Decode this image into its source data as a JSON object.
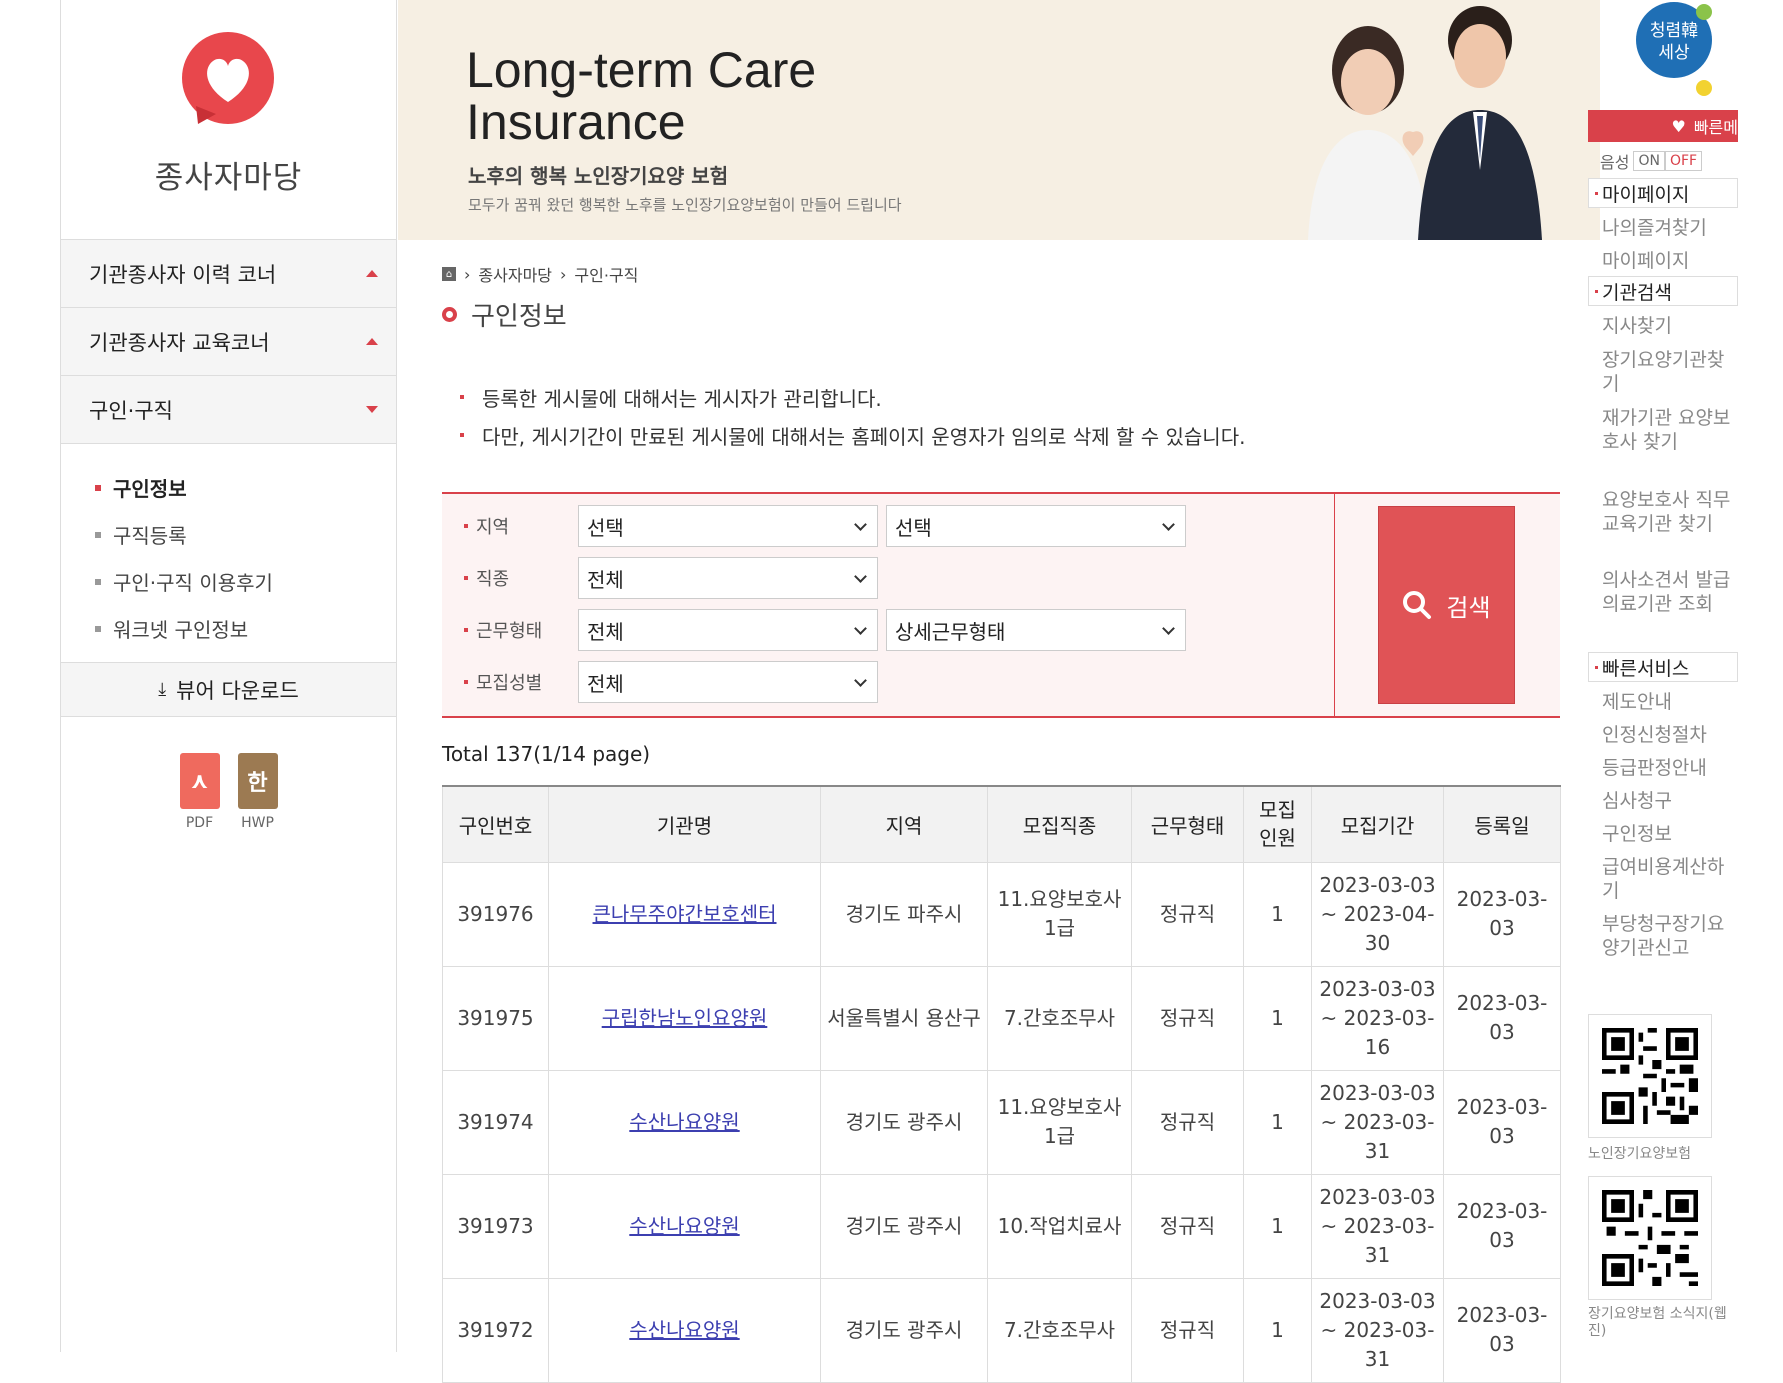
{
  "brand": {
    "name": "종사자마당",
    "logo_icon": "heart-speech-icon"
  },
  "banner": {
    "title_line1": "Long-term Care",
    "title_line2": "Insurance",
    "subtitle": "노후의 행복 노인장기요양 보험",
    "description": "모두가 꿈꿔 왔던 행복한 노후를 노인장기요양보험이 만들어 드립니다"
  },
  "sidebar": {
    "menu": [
      {
        "label": "기관종사자 이력 코너",
        "expanded": false
      },
      {
        "label": "기관종사자 교육코너",
        "expanded": false
      },
      {
        "label": "구인·구직",
        "expanded": true
      }
    ],
    "submenu": [
      {
        "label": "구인정보",
        "active": true
      },
      {
        "label": "구직등록"
      },
      {
        "label": "구인·구직 이용후기"
      },
      {
        "label": "워크넷 구인정보"
      }
    ],
    "viewer_download": "뷰어 다운로드",
    "viewer_pdf": "PDF",
    "viewer_hwp": "HWP",
    "viewer_hwp_glyph": "한"
  },
  "breadcrumb": {
    "home_icon": "home-icon",
    "items": [
      "종사자마당",
      "구인·구직"
    ]
  },
  "page_title": "구인정보",
  "notices": [
    "등록한 게시물에 대해서는 게시자가 관리합니다.",
    "다만, 게시기간이 만료된 게시물에 대해서는 홈페이지 운영자가 임의로 삭제 할 수 있습니다."
  ],
  "search": {
    "region_label": "지역",
    "region_value1": "선택",
    "region_value2": "선택",
    "job_label": "직종",
    "job_value": "전체",
    "work_type_label": "근무형태",
    "work_type_value": "전체",
    "work_type_detail": "상세근무형태",
    "gender_label": "모집성별",
    "gender_value": "전체",
    "button_label": "검색"
  },
  "total_text": "Total 137(1/14 page)",
  "table": {
    "headers": [
      "구인번호",
      "기관명",
      "지역",
      "모집직종",
      "근무형태",
      "모집\n인원",
      "모집기간",
      "등록일"
    ],
    "rows": [
      [
        "391976",
        "큰나무주야간보호센터",
        "경기도 파주시",
        "11.요양보호사 1급",
        "정규직",
        "1",
        "2023-03-03 ~ 2023-04-30",
        "2023-03-03"
      ],
      [
        "391975",
        "구립한남노인요양원",
        "서울특별시 용산구",
        "7.간호조무사",
        "정규직",
        "1",
        "2023-03-03 ~ 2023-03-16",
        "2023-03-03"
      ],
      [
        "391974",
        "수산나요양원",
        "경기도 광주시",
        "11.요양보호사 1급",
        "정규직",
        "1",
        "2023-03-03 ~ 2023-03-31",
        "2023-03-03"
      ],
      [
        "391973",
        "수산나요양원",
        "경기도 광주시",
        "10.작업치료사",
        "정규직",
        "1",
        "2023-03-03 ~ 2023-03-31",
        "2023-03-03"
      ],
      [
        "391972",
        "수산나요양원",
        "경기도 광주시",
        "7.간호조무사",
        "정규직",
        "1",
        "2023-03-03 ~ 2023-03-31",
        "2023-03-03"
      ]
    ]
  },
  "quick": {
    "logo_text": "청렴韓 세상",
    "header": "빠른메",
    "voice_label": "음성",
    "voice_on": "ON",
    "voice_off": "OFF",
    "mypage_title": "마이페이지",
    "mypage_links": [
      "나의즐겨찾기",
      "마이페이지"
    ],
    "search_title": "기관검색",
    "search_links": [
      "지사찾기",
      "장기요양기관찾기",
      "재가기관 요양보호사 찾기",
      "요양보호사 직무교육기관 찾기",
      "의사소견서 발급 의료기관 조회"
    ],
    "service_title": "빠른서비스",
    "service_links": [
      "제도안내",
      "인정신청절차",
      "등급판정안내",
      "심사청구",
      "구인정보",
      "급여비용계산하기",
      "부당청구장기요양기관신고"
    ],
    "qr1_caption": "노인장기요양보험",
    "qr2_caption": "장기요양보험 소식지(웹진)"
  },
  "colors": {
    "accent": "#d9414a",
    "banner_bg": "#f6efe3",
    "search_bg": "#fdf3f3",
    "link": "#3c3fb0"
  }
}
